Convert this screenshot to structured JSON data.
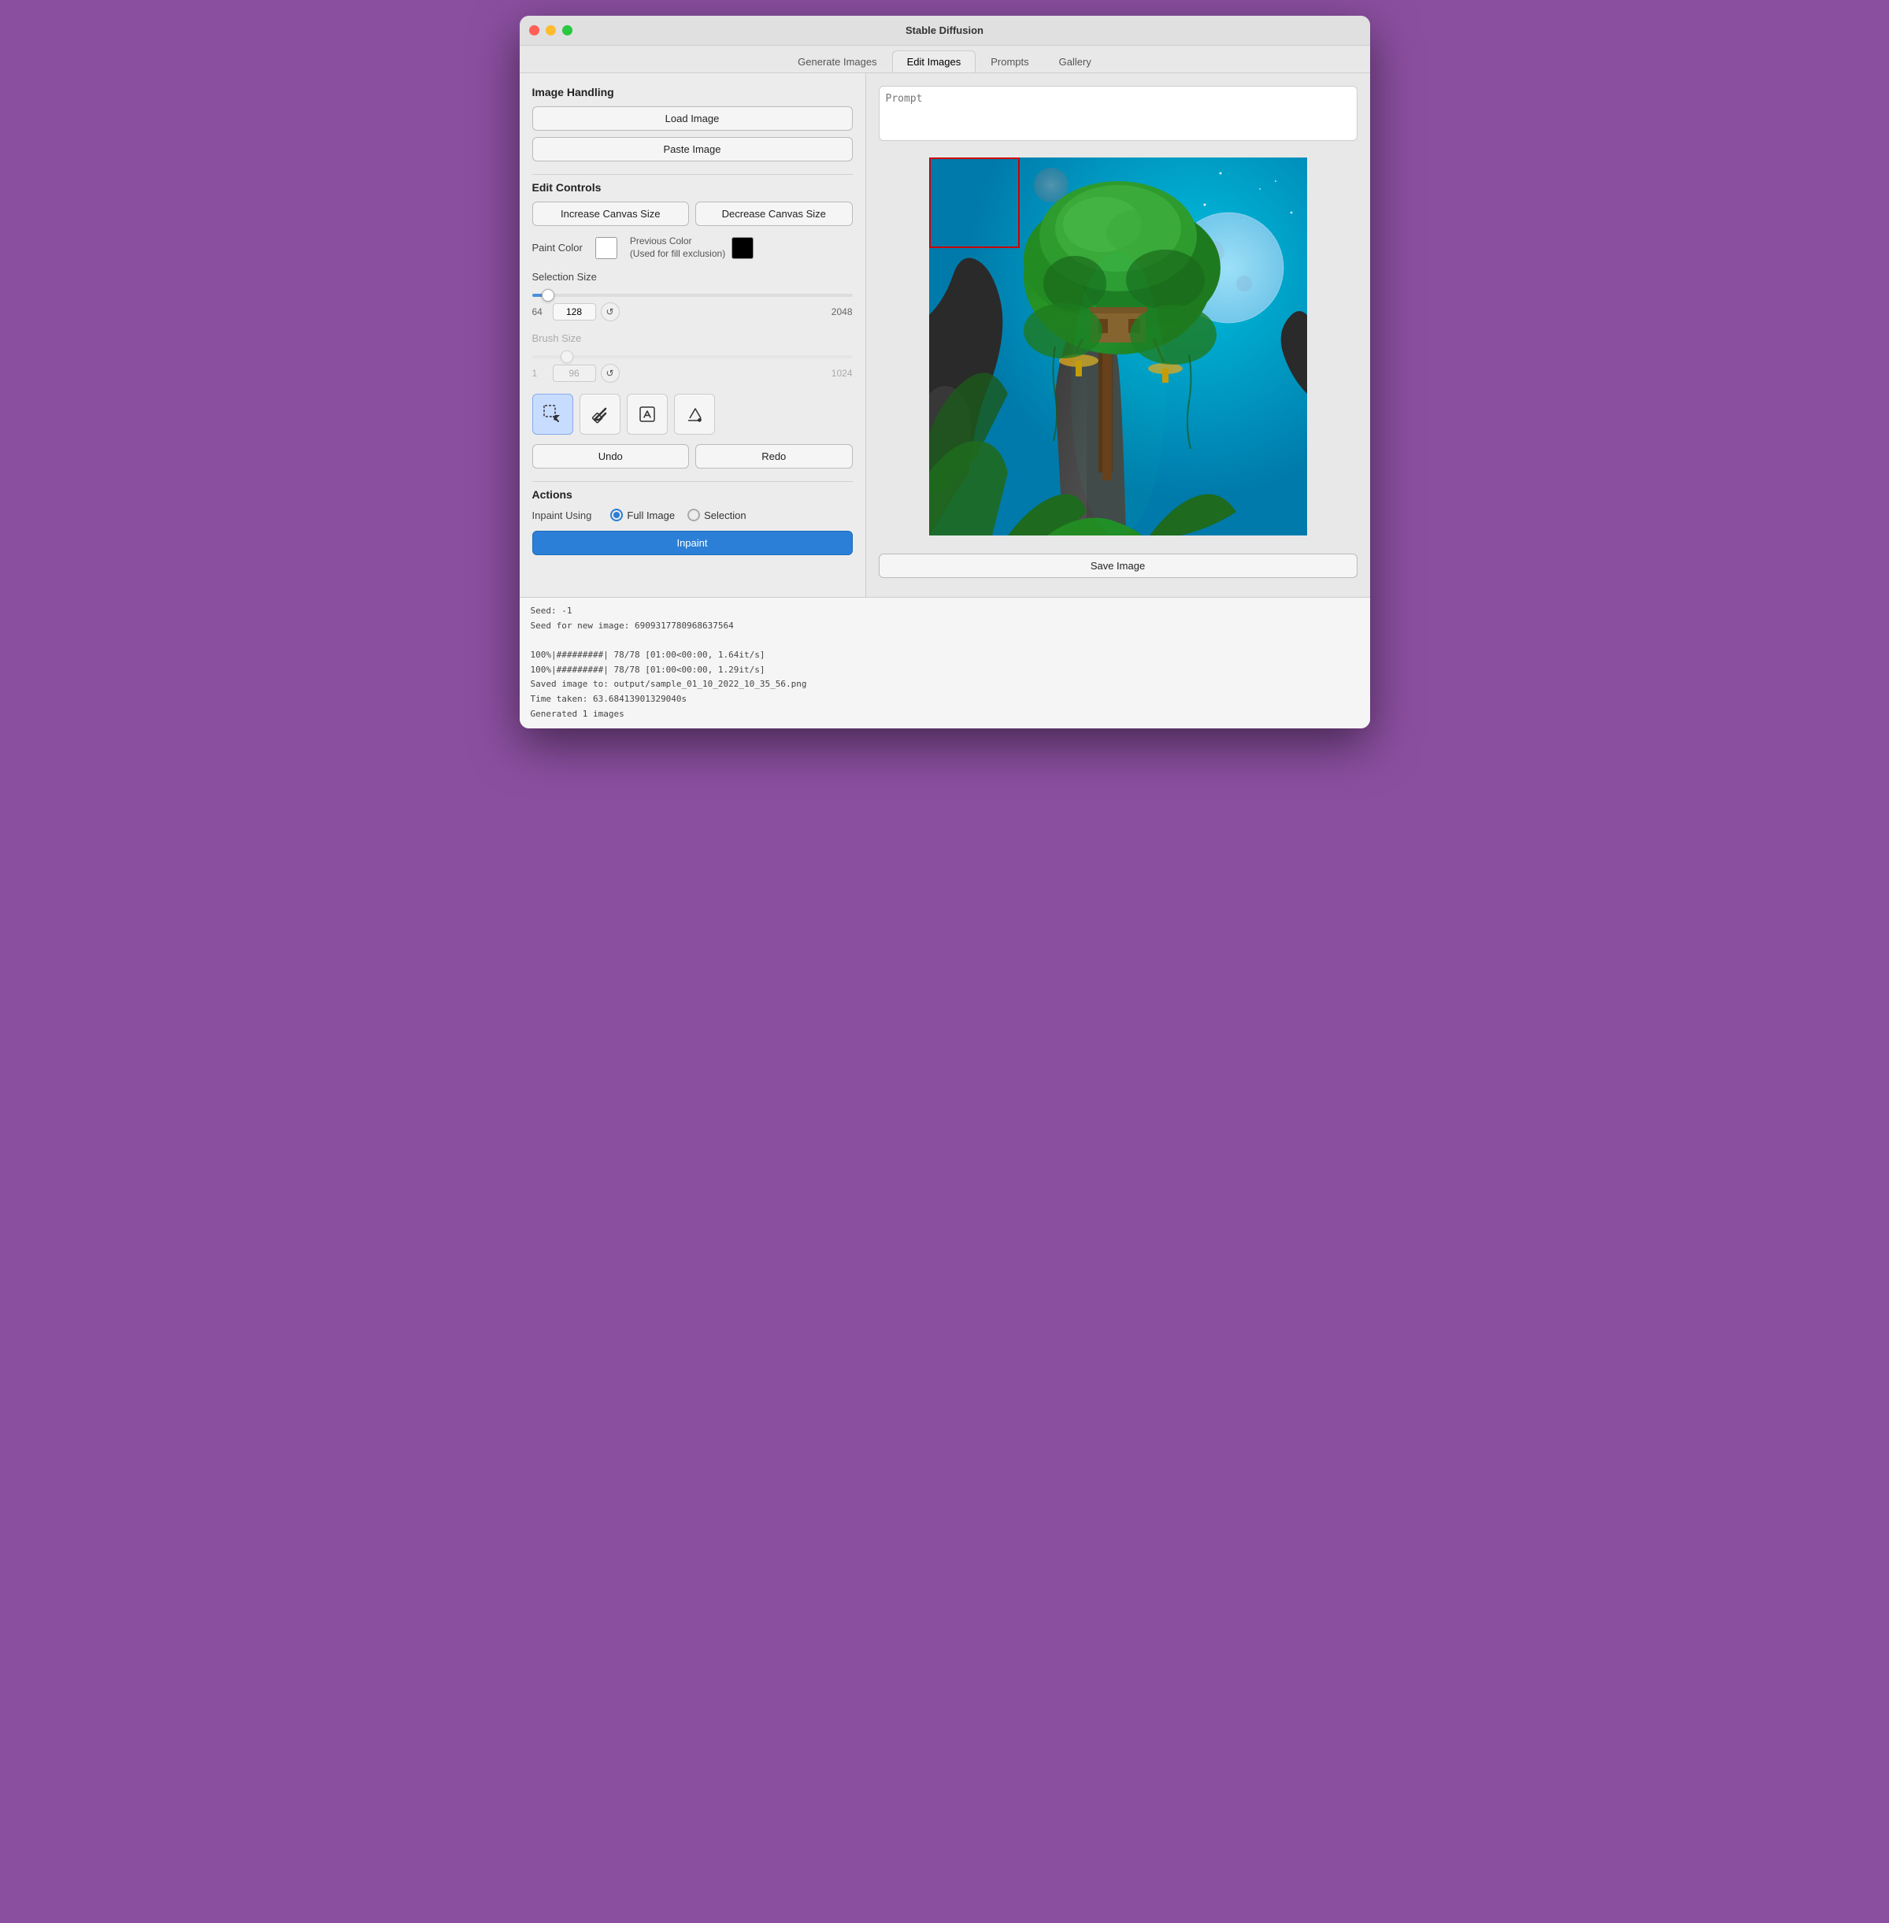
{
  "window": {
    "title": "Stable Diffusion"
  },
  "tabs": [
    {
      "id": "generate",
      "label": "Generate Images",
      "active": false
    },
    {
      "id": "edit",
      "label": "Edit Images",
      "active": true
    },
    {
      "id": "prompts",
      "label": "Prompts",
      "active": false
    },
    {
      "id": "gallery",
      "label": "Gallery",
      "active": false
    }
  ],
  "left_panel": {
    "image_handling": {
      "title": "Image Handling",
      "load_btn": "Load Image",
      "paste_btn": "Paste Image"
    },
    "edit_controls": {
      "title": "Edit Controls",
      "increase_canvas_btn": "Increase Canvas Size",
      "decrease_canvas_btn": "Decrease Canvas Size",
      "paint_color_label": "Paint Color",
      "prev_color_label": "Previous Color\n(Used for fill exclusion)",
      "selection_size_label": "Selection Size",
      "selection_min": "64",
      "selection_value": "128",
      "selection_max": "2048",
      "brush_size_label": "Brush Size",
      "brush_min": "1",
      "brush_value": "96",
      "brush_max": "1024",
      "undo_btn": "Undo",
      "redo_btn": "Redo"
    },
    "actions": {
      "title": "Actions",
      "inpaint_using_label": "Inpaint Using",
      "radio_full_image": "Full Image",
      "radio_selection": "Selection",
      "inpaint_btn": "Inpaint"
    }
  },
  "right_panel": {
    "prompt_placeholder": "Prompt",
    "save_btn": "Save Image"
  },
  "status_bar": {
    "line1": "Seed: -1",
    "line2": "Seed for new image: 6909317780968637564",
    "line3": "",
    "line4": "100%|#########| 78/78 [01:00<00:00,  1.64it/s]",
    "line5": "100%|#########| 78/78 [01:00<00:00,  1.29it/s]",
    "line6": "Saved image to: output/sample_01_10_2022_10_35_56.png",
    "line7": "Time taken: 63.68413901329040s",
    "line8": "Generated 1 images"
  }
}
